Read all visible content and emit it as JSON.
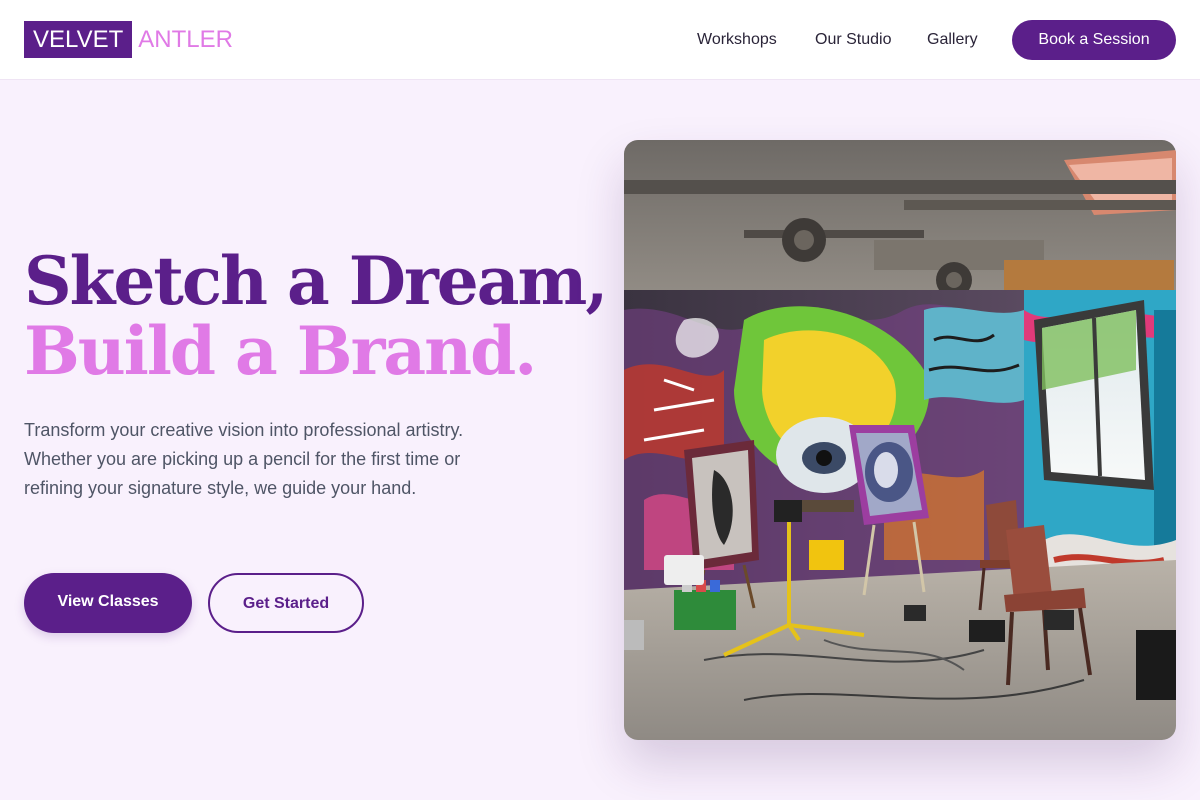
{
  "brand": {
    "name_primary": "VELVET",
    "name_accent": "ANTLER"
  },
  "nav": {
    "links": [
      "Workshops",
      "Our Studio",
      "Gallery"
    ],
    "cta": "Book a Session"
  },
  "hero": {
    "title_line1": "Sketch a Dream,",
    "title_line2": "Build a Brand.",
    "description": "Transform your creative vision into professional artistry. Whether you are picking up a pencil for the first time or refining your signature style, we guide your hand.",
    "primary_button": "View Classes",
    "secondary_button": "Get Started",
    "image_subject": "graffiti-covered art studio with easels, paintings, chairs and a tripod lamp"
  },
  "colors": {
    "brand_purple": "#5b1f8a",
    "accent_pink": "#e07ae6",
    "page_background": "#f9f1fd",
    "body_text": "#4f5566"
  }
}
